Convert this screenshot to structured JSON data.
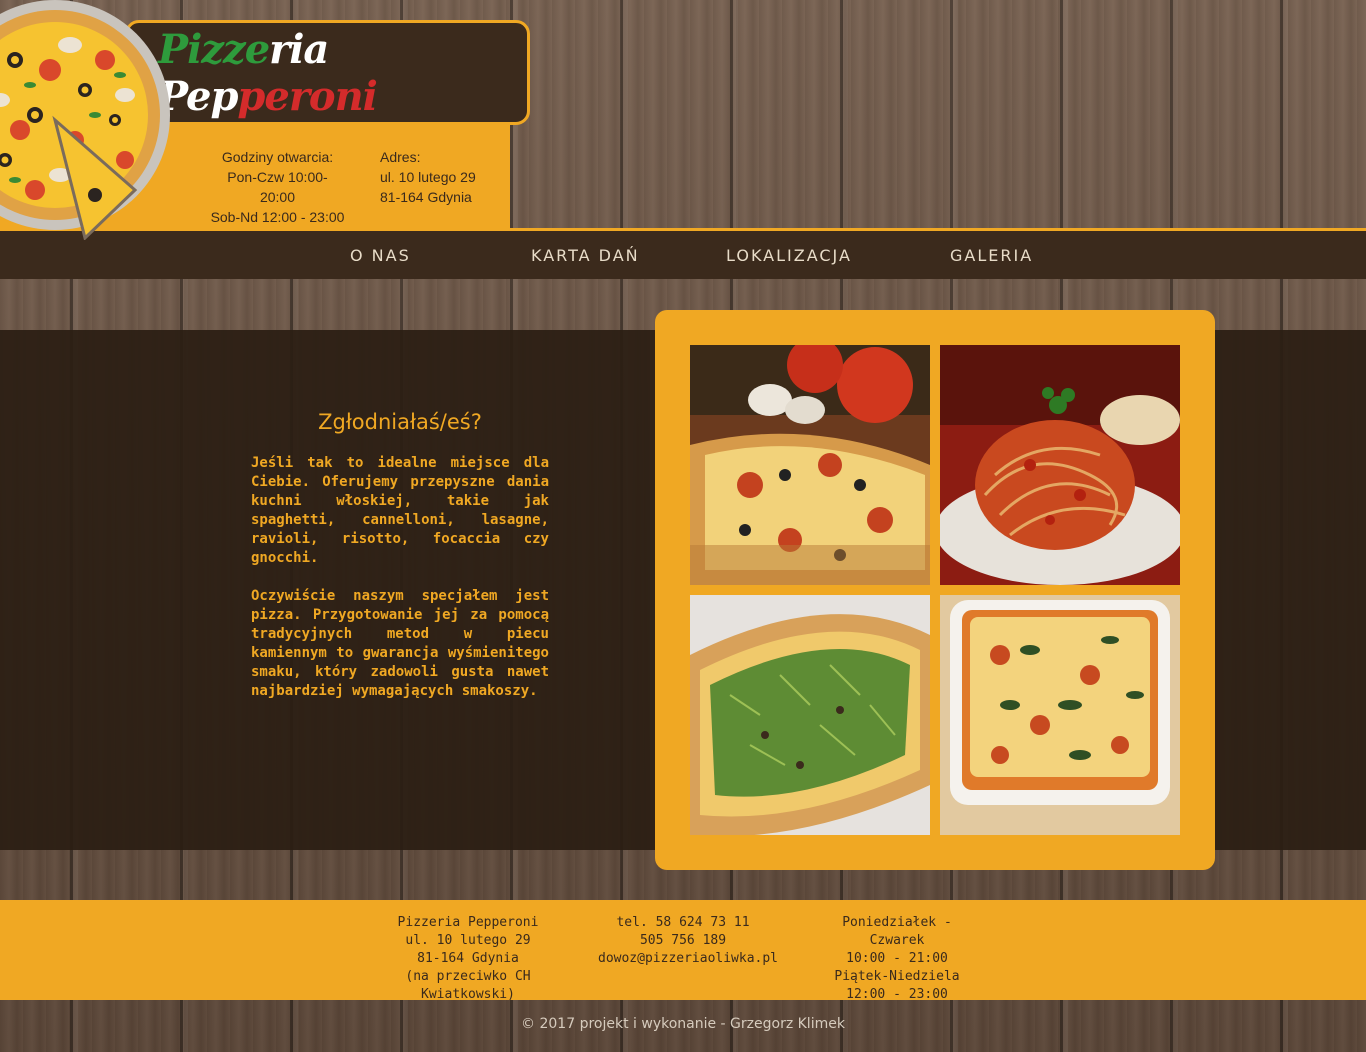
{
  "brand": {
    "part1": "Pizze",
    "part2": "ria Pep",
    "part3": "peroni"
  },
  "hours": {
    "label": "Godziny otwarcia:",
    "weekdays": "Pon-Czw 10:00-20:00",
    "weekend": "Sob-Nd 12:00 - 23:00"
  },
  "address": {
    "label": "Adres:",
    "street": "ul. 10 lutego 29",
    "city": "81-164 Gdynia"
  },
  "nav": {
    "items": [
      {
        "label": "O NAS"
      },
      {
        "label": "KARTA DAŃ"
      },
      {
        "label": "LOKALIZACJA"
      },
      {
        "label": "GALERIA"
      }
    ]
  },
  "main": {
    "heading": "Zgłodniałaś/eś?",
    "paragraph1": "Jeśli tak to idealne miejsce dla Ciebie. Oferujemy przepyszne dania kuchni włoskiej, takie jak spaghetti, cannelloni, lasagne, ravioli, risotto, focaccia czy gnocchi.",
    "paragraph2": "Oczywiście naszym specjałem jest pizza. Przygotowanie jej za pomocą tradycyjnych metod w piecu kamiennym to gwarancja wyśmienitego smaku, który zadowoli gusta nawet najbardziej wymagających smakoszy."
  },
  "gallery": {
    "photos": [
      {
        "icon": "pizza-photo"
      },
      {
        "icon": "spaghetti-photo"
      },
      {
        "icon": "flatbread-photo"
      },
      {
        "icon": "lasagne-photo"
      }
    ]
  },
  "footer": {
    "col1": [
      "Pizzeria Pepperoni",
      "ul. 10 lutego 29",
      "81-164 Gdynia",
      "(na przeciwko CH Kwiatkowski)"
    ],
    "col2": [
      "tel. 58 624 73 11",
      "505 756 189",
      "dowoz@pizzeriaoliwka.pl"
    ],
    "col3": [
      "Poniedziałek - Czwarek",
      "10:00 - 21:00",
      "Piątek-Niedziela",
      "12:00 - 23:00"
    ]
  },
  "copyright": "© 2017 projekt i wykonanie - Grzegorz Klimek",
  "colors": {
    "accent": "#f0a823",
    "dark": "#3b2a1c",
    "brand_green": "#2e9b3c",
    "brand_red": "#d42b2b"
  }
}
